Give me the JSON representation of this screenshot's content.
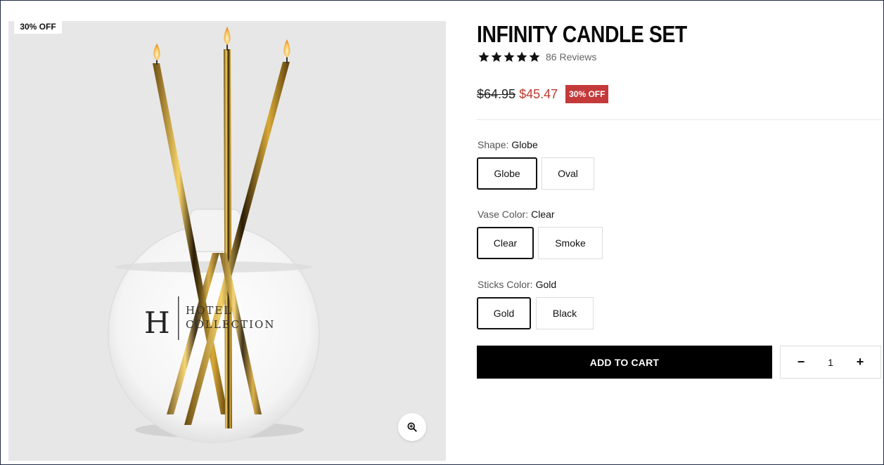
{
  "product": {
    "title": "INFINITY CANDLE SET",
    "reviews_text": "86 Reviews",
    "rating": 5,
    "image_badge": "30% OFF",
    "image_brand_letter": "H",
    "image_brand_line1": "HOTEL",
    "image_brand_line2": "COLLECTION"
  },
  "pricing": {
    "old_price": "$64.95",
    "new_price": "$45.47",
    "badge": "30% OFF"
  },
  "options": {
    "shape": {
      "label": "Shape:",
      "value": "Globe",
      "choices": [
        "Globe",
        "Oval"
      ]
    },
    "vase_color": {
      "label": "Vase Color:",
      "value": "Clear",
      "choices": [
        "Clear",
        "Smoke"
      ]
    },
    "sticks_color": {
      "label": "Sticks Color:",
      "value": "Gold",
      "choices": [
        "Gold",
        "Black"
      ]
    }
  },
  "cart": {
    "add_label": "ADD TO CART",
    "minus": "−",
    "plus": "+",
    "quantity": "1"
  },
  "icons": {
    "zoom": "zoom-in-icon",
    "star": "star-icon"
  },
  "colors": {
    "sale_red": "#c43a3a",
    "price_red": "#c0392f",
    "button_black": "#000000",
    "gold": "#c9a227"
  }
}
